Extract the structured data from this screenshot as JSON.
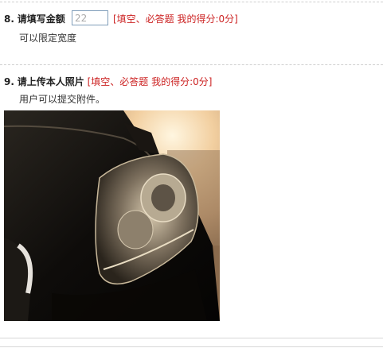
{
  "q8": {
    "number": "8.",
    "title": "请填写金额",
    "input_value": "22",
    "tag": "[填空、必答题   我的得分:0分]",
    "description": "可以限定宽度"
  },
  "q9": {
    "number": "9.",
    "title": "请上传本人照片",
    "tag": "[填空、必答题   我的得分:0分]",
    "description": "用户可以提交附件。"
  },
  "colors": {
    "tag": "#cc2222",
    "input_border": "#7f9db9",
    "divider": "#cfcfcf"
  }
}
